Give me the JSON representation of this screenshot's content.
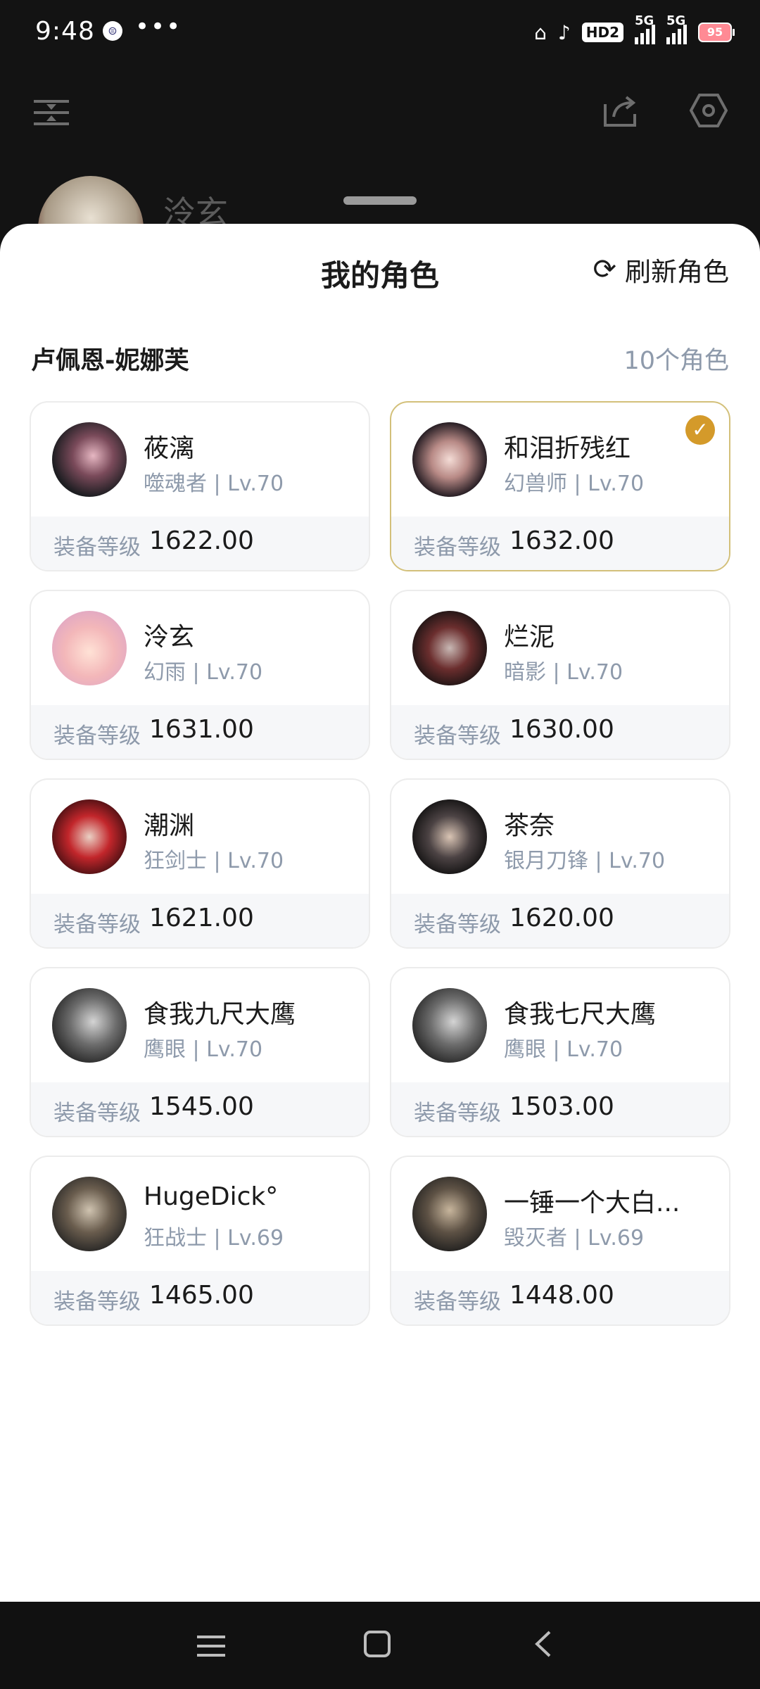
{
  "status_bar": {
    "time": "9:48",
    "app_badge": "⊜",
    "more": "•••",
    "hd": "HD2",
    "sig1_label": "5G",
    "sig2_label": "5G",
    "battery": "95"
  },
  "header": {
    "username": "泠玄"
  },
  "sheet": {
    "title": "我的角色",
    "refresh_label": "刷新角色",
    "server_name": "卢佩恩-妮娜芙",
    "role_count": "10个角色",
    "gear_label": "装备等级"
  },
  "characters": [
    {
      "name": "莜漓",
      "class_level": "噬魂者 | Lv.70",
      "gear_score": "1622.00",
      "selected": false
    },
    {
      "name": "和泪折残红",
      "class_level": "幻兽师 | Lv.70",
      "gear_score": "1632.00",
      "selected": true
    },
    {
      "name": "泠玄",
      "class_level": "幻雨 | Lv.70",
      "gear_score": "1631.00",
      "selected": false
    },
    {
      "name": "烂泥",
      "class_level": "暗影 | Lv.70",
      "gear_score": "1630.00",
      "selected": false
    },
    {
      "name": "潮渊",
      "class_level": "狂剑士 | Lv.70",
      "gear_score": "1621.00",
      "selected": false
    },
    {
      "name": "茶奈",
      "class_level": "银月刀锋 | Lv.70",
      "gear_score": "1620.00",
      "selected": false
    },
    {
      "name": "食我九尺大鹰",
      "class_level": "鹰眼 | Lv.70",
      "gear_score": "1545.00",
      "selected": false
    },
    {
      "name": "食我七尺大鹰",
      "class_level": "鹰眼 | Lv.70",
      "gear_score": "1503.00",
      "selected": false
    },
    {
      "name": "HugeDick°",
      "class_level": "狂战士 | Lv.69",
      "gear_score": "1465.00",
      "selected": false
    },
    {
      "name": "一锤一个大白...",
      "class_level": "毁灭者 | Lv.69",
      "gear_score": "1448.00",
      "selected": false
    }
  ],
  "colors": {
    "selected_border": "#d3c07a",
    "check_badge": "#d49a2a",
    "muted_text": "#8e9aab"
  },
  "icons": {
    "menu": "filter-menu-icon",
    "share": "share-icon",
    "settings": "hexagon-settings-icon",
    "refresh": "refresh-icon",
    "check": "check-icon",
    "nav_menu": "nav-menu-icon",
    "nav_home": "nav-home-icon",
    "nav_back": "nav-back-icon"
  }
}
